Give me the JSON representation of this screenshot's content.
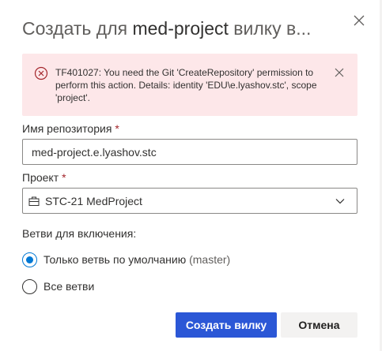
{
  "dialog": {
    "title_prefix": "Создать для ",
    "title_project": "med-project",
    "title_suffix": " вилку в..."
  },
  "error": {
    "message": "TF401027: You need the Git 'CreateRepository' permission to perform this action. Details: identity 'EDU\\e.lyashov.stc', scope 'project'."
  },
  "repo_name": {
    "label": "Имя репозитория",
    "required_mark": "*",
    "value": "med-project.e.lyashov.stc"
  },
  "project": {
    "label": "Проект",
    "required_mark": "*",
    "selected": "STC-21 MedProject"
  },
  "branches": {
    "label": "Ветви для включения:",
    "options": [
      {
        "label": "Только ветвь по умолчанию",
        "hint": "(master)",
        "checked": true
      },
      {
        "label": "Все ветви",
        "hint": "",
        "checked": false
      }
    ]
  },
  "buttons": {
    "create": "Создать вилку",
    "cancel": "Отмена"
  },
  "colors": {
    "primary": "#2b57d6",
    "error_bg": "#fde7e9",
    "error_icon": "#a4262c",
    "radio_selected": "#0078d4"
  },
  "icons": {
    "close": "close-icon",
    "error": "error-circle-icon",
    "dismiss": "dismiss-icon",
    "project": "project-briefcase-icon",
    "dropdown": "chevron-down-icon"
  }
}
